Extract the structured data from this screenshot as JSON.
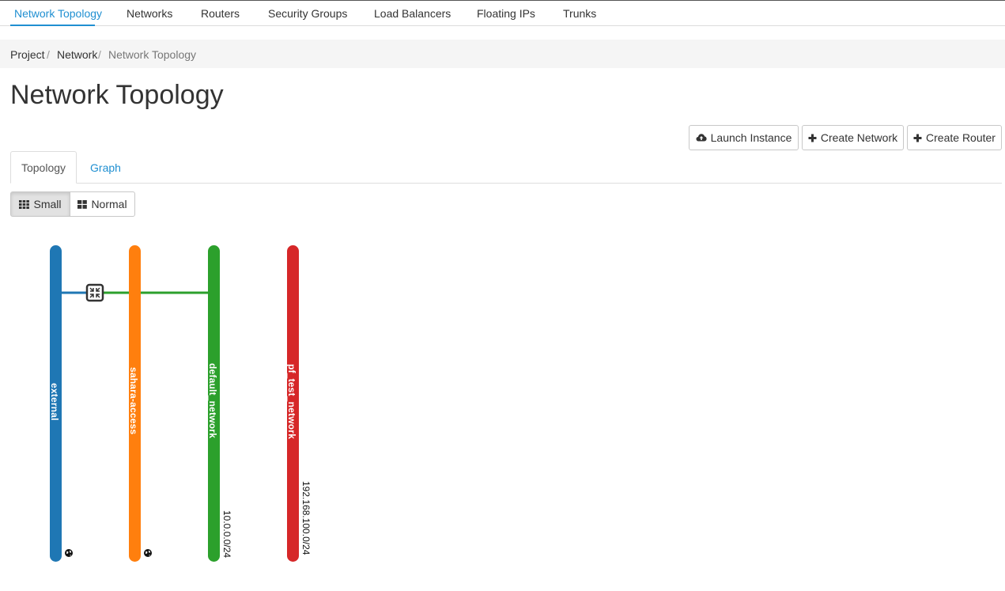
{
  "nav": {
    "tabs": [
      {
        "label": "Network Topology"
      },
      {
        "label": "Networks"
      },
      {
        "label": "Routers"
      },
      {
        "label": "Security Groups"
      },
      {
        "label": "Load Balancers"
      },
      {
        "label": "Floating IPs"
      },
      {
        "label": "Trunks"
      }
    ]
  },
  "breadcrumb": {
    "items": [
      "Project",
      "Network",
      "Network Topology"
    ],
    "separator": "/"
  },
  "page": {
    "title": "Network Topology"
  },
  "actions": {
    "launch_instance": "Launch Instance",
    "create_network": "Create Network",
    "create_router": "Create Router"
  },
  "view_tabs": {
    "topology": "Topology",
    "graph": "Graph"
  },
  "size_toggle": {
    "small": "Small",
    "normal": "Normal",
    "selected": "Small"
  },
  "topology": {
    "networks": [
      {
        "name": "external",
        "color": "#1f77b4",
        "cidr": "",
        "external": true
      },
      {
        "name": "sahara-access",
        "color": "#ff7f0e",
        "cidr": "",
        "external": true
      },
      {
        "name": "default_network",
        "color": "#2ca02c",
        "cidr": "10.0.0.0/24",
        "external": false
      },
      {
        "name": "pf_test_network",
        "color": "#d62728",
        "cidr": "192.168.100.0/24",
        "external": false
      }
    ],
    "router": {
      "icon": "router-icon",
      "gateway_color": "#1f77b4",
      "interface_color": "#2ca02c"
    }
  },
  "colors": {
    "accent": "#1f8fd1"
  }
}
